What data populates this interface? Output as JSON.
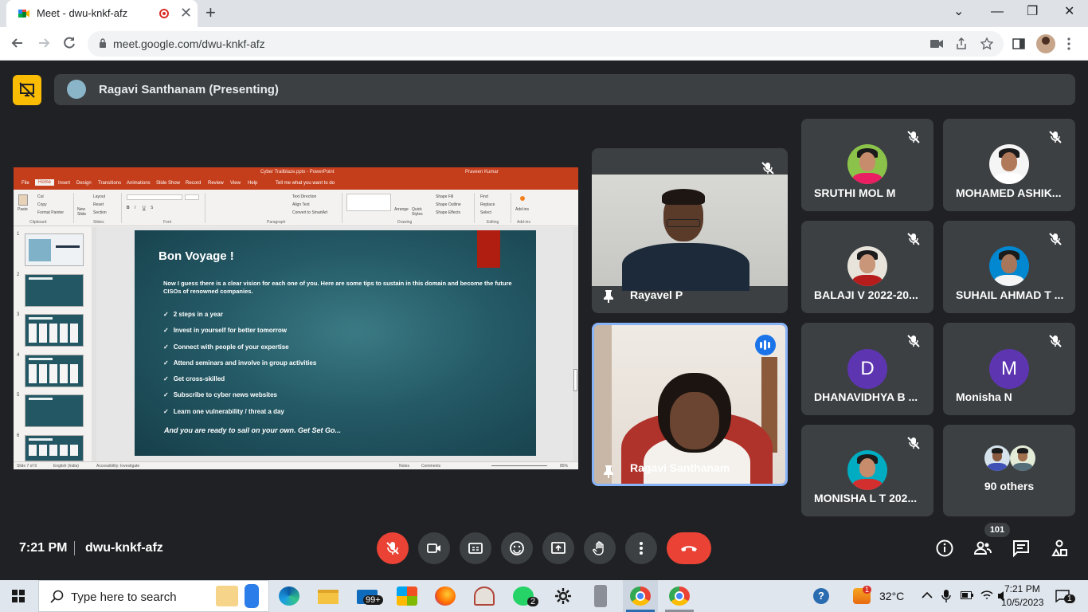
{
  "browser": {
    "tab_title": "Meet - dwu-knkf-afz",
    "close_label": "✕",
    "newtab_label": "+",
    "url": "meet.google.com/dwu-knkf-afz",
    "window_controls": [
      "⌄",
      "—",
      "❐",
      "✕"
    ]
  },
  "presenting": {
    "label": "Ragavi Santhanam (Presenting)"
  },
  "powerpoint": {
    "file_title": "Cyber Trailblaze.pptx - PowerPoint",
    "user": "Praveen Kumar",
    "menu": [
      "File",
      "Home",
      "Insert",
      "Design",
      "Transitions",
      "Animations",
      "Slide Show",
      "Record",
      "Review",
      "View",
      "Help",
      "Tell me what you want to do"
    ],
    "ribbon": {
      "paste": "Paste",
      "cut": "Cut",
      "copy": "Copy",
      "format_painter": "Format Painter",
      "new_slide": "New Slide",
      "layout": "Layout",
      "reset": "Reset",
      "section": "Section",
      "text_direction": "Text Direction",
      "align_text": "Align Text",
      "convert_smartart": "Convert to SmartArt",
      "arrange": "Arrange",
      "quick_styles": "Quick Styles",
      "shape_fill": "Shape Fill",
      "shape_outline": "Shape Outline",
      "shape_effects": "Shape Effects",
      "find": "Find",
      "replace": "Replace",
      "select": "Select",
      "addins": "Add-ins",
      "groups": [
        "Clipboard",
        "Slides",
        "Font",
        "Paragraph",
        "Drawing",
        "Editing",
        "Add-ins"
      ]
    },
    "thumb_numbers": [
      "1",
      "2",
      "3",
      "4",
      "5",
      "6"
    ],
    "slide": {
      "title": "Bon Voyage !",
      "intro": "Now I guess there is a clear vision for each one of you. Here are some tips to sustain in this domain and become the future CISOs of renowned companies.",
      "bullets": [
        "2 steps in a year",
        "Invest in yourself for better tomorrow",
        "Connect with people of your expertise",
        "Attend seminars and involve in group activities",
        "Get cross-skilled",
        "Subscribe to cyber news websites",
        "Learn one vulnerability / threat a day"
      ],
      "outro": "And you are ready to sail on your own. Get Set Go..."
    },
    "status": {
      "slide_info": "Slide 7 of 9",
      "language": "English (India)",
      "accessibility": "Accessibility: Investigate",
      "notes": "Notes",
      "comments": "Comments",
      "zoom": "85%"
    }
  },
  "video_tiles": [
    {
      "name": "Rayavel P"
    },
    {
      "name": "Ragavi Santhanam"
    }
  ],
  "participants": [
    {
      "name": "SRUTHI MOL M"
    },
    {
      "name": "MOHAMED ASHIK..."
    },
    {
      "name": "BALAJI V 2022-20..."
    },
    {
      "name": "SUHAIL AHMAD T ..."
    },
    {
      "name": "DHANAVIDHYA B ...",
      "initial": "D",
      "color": "#5e35b1"
    },
    {
      "name": "Monisha N",
      "initial": "M",
      "color": "#5e35b1"
    },
    {
      "name": "MONISHA L T 202..."
    }
  ],
  "others": {
    "label": "90 others"
  },
  "controls": {
    "time": "7:21 PM",
    "meeting_code": "dwu-knkf-afz",
    "people_count": "101"
  },
  "taskbar": {
    "search_placeholder": "Type here to search",
    "mail_badge": "99+",
    "whatsapp_badge": "2",
    "weather_badge": "1",
    "temperature": "32°C",
    "time": "7:21 PM",
    "date": "10/5/2023",
    "notification_count": "1"
  },
  "colors": {
    "meet_bg": "#202124",
    "tile_bg": "#3c4043",
    "end_call": "#ea4335",
    "ppt_accent": "#c43e1c",
    "presenting_badge": "#fbbc04",
    "speaking_blue": "#1a73e8"
  }
}
